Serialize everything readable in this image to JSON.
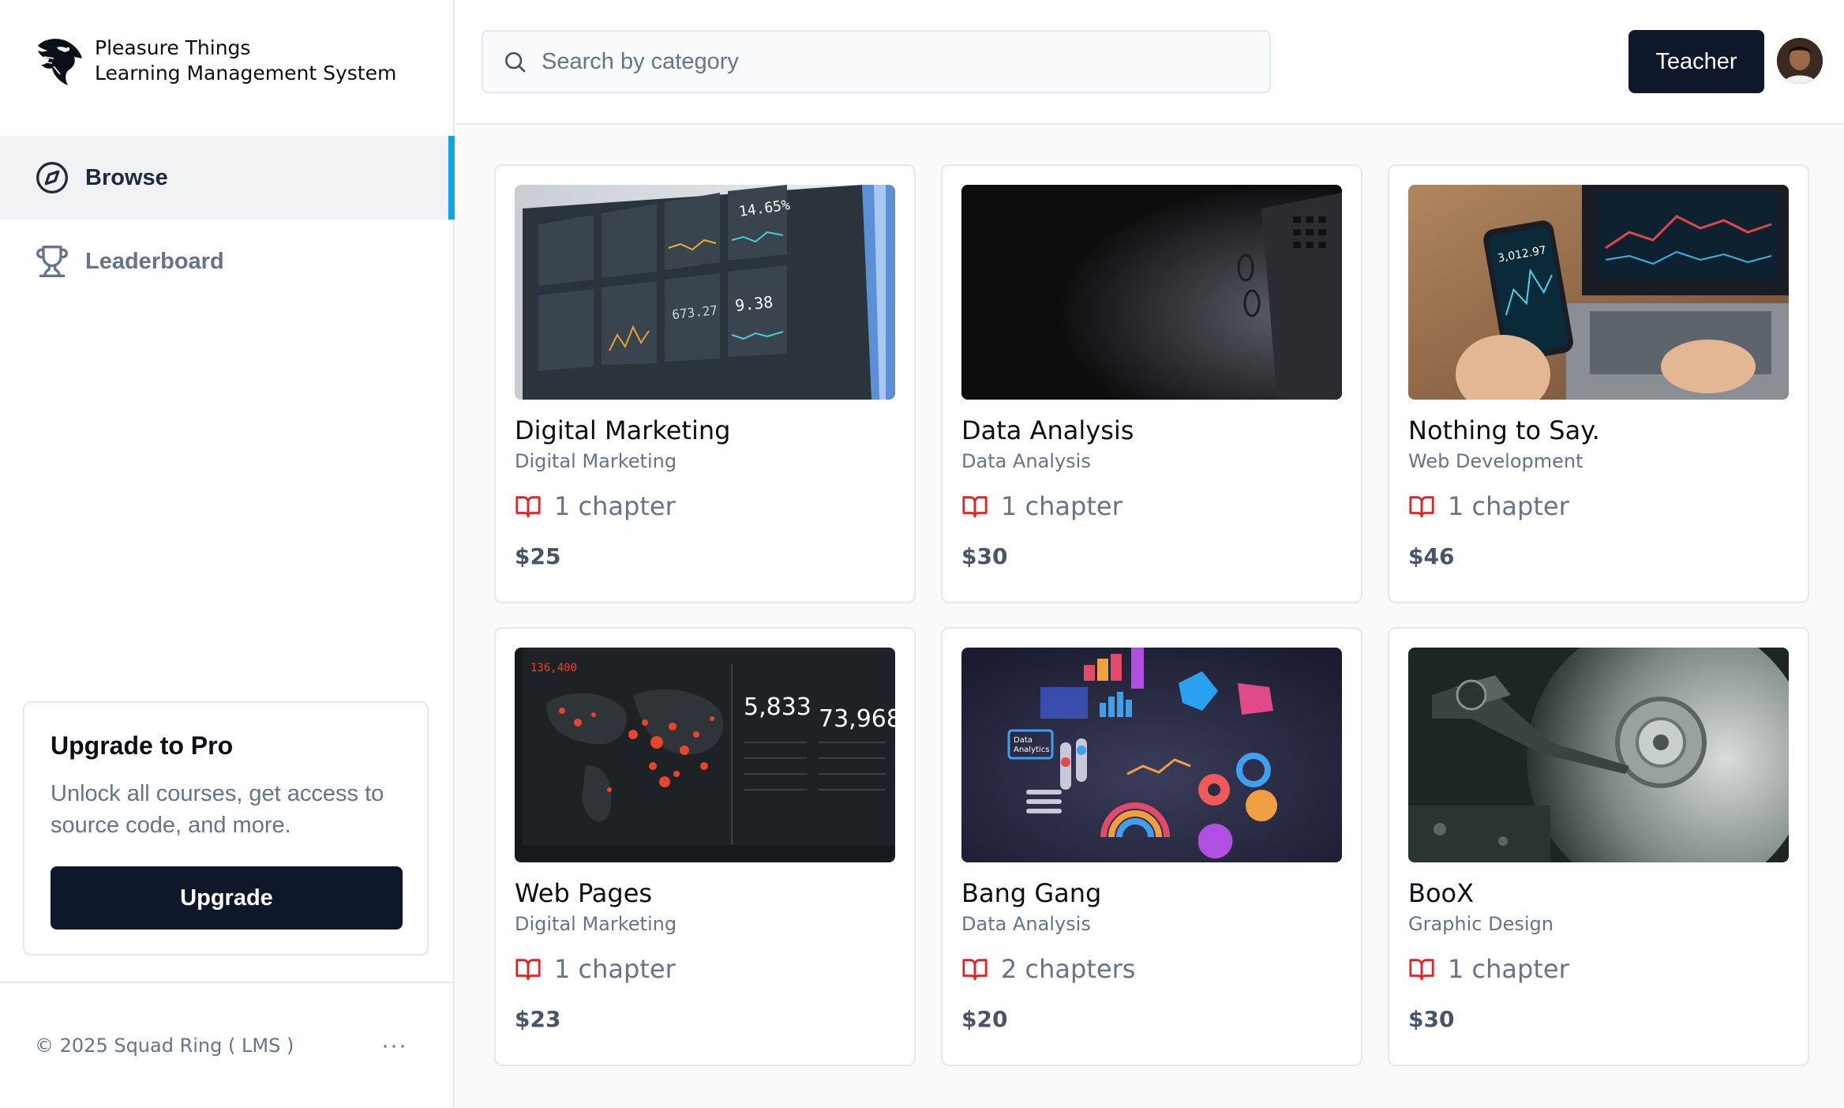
{
  "app": {
    "name_line1": "Pleasure Things",
    "name_line2": "Learning Management System"
  },
  "sidebar": {
    "items": [
      {
        "label": "Browse",
        "icon": "compass-icon",
        "active": true
      },
      {
        "label": "Leaderboard",
        "icon": "trophy-icon",
        "active": false
      }
    ],
    "upgrade": {
      "title": "Upgrade to Pro",
      "description": "Unlock all courses, get access to source code, and more.",
      "button": "Upgrade"
    },
    "footer": {
      "copyright": "© 2025 Squad Ring ( LMS )",
      "more": "···"
    }
  },
  "header": {
    "search_placeholder": "Search by category",
    "teacher_button": "Teacher"
  },
  "colors": {
    "accent": "#0ea5e9",
    "primary": "#0f172a",
    "chapter_icon": "#dc2626"
  },
  "courses": [
    {
      "title": "Digital Marketing",
      "category": "Digital Marketing",
      "chapters": "1 chapter",
      "price": "$25",
      "image": "dashboard-screens"
    },
    {
      "title": "Data Analysis",
      "category": "Data Analysis",
      "chapters": "1 chapter",
      "price": "$30",
      "image": "dark-desk-laptop"
    },
    {
      "title": "Nothing to Say.",
      "category": "Web Development",
      "chapters": "1 chapter",
      "price": "$46",
      "image": "phone-trading"
    },
    {
      "title": "Web Pages",
      "category": "Digital Marketing",
      "chapters": "1 chapter",
      "price": "$23",
      "image": "world-map-dashboard"
    },
    {
      "title": "Bang Gang",
      "category": "Data Analysis",
      "chapters": "2 chapters",
      "price": "$20",
      "image": "3d-analytics"
    },
    {
      "title": "BooX",
      "category": "Graphic Design",
      "chapters": "1 chapter",
      "price": "$30",
      "image": "hard-drive"
    }
  ]
}
